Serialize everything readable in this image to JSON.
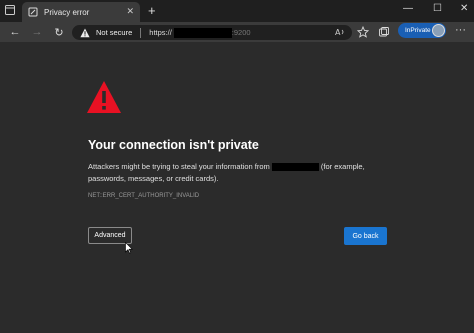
{
  "tab": {
    "title": "Privacy error",
    "close": "✕",
    "new_tab": "+"
  },
  "window_controls": {
    "minimize": "—",
    "maximize": "☐",
    "close": "✕"
  },
  "toolbar": {
    "back": "←",
    "forward": "→",
    "refresh": "↻",
    "not_secure": "Not secure",
    "url_scheme": "https://",
    "url_port": ":9200",
    "inprivate": "InPrivate",
    "more": "···"
  },
  "page": {
    "heading": "Your connection isn't private",
    "desc_before": "Attackers might be trying to steal your information from ",
    "desc_after": " (for example, passwords, messages, or credit cards).",
    "error_code": "NET::ERR_CERT_AUTHORITY_INVALID",
    "advanced_label": "Advanced",
    "go_back_label": "Go back"
  },
  "colors": {
    "page_bg": "#2b2b2b",
    "warning_red": "#e81123",
    "primary_blue": "#1a75d0",
    "inprivate_blue": "#1a5fb4"
  }
}
